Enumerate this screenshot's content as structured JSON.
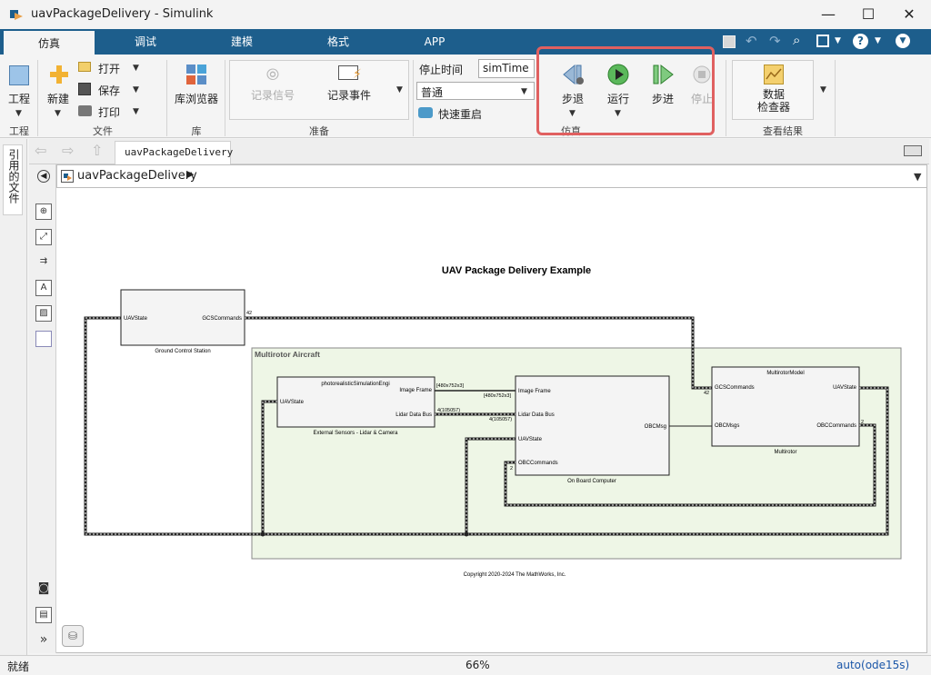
{
  "window": {
    "title": "uavPackageDelivery - Simulink",
    "minimize": "—",
    "maximize": "☐",
    "close": "✕"
  },
  "tabs": [
    {
      "label": "仿真",
      "active": true
    },
    {
      "label": "调试"
    },
    {
      "label": "建模"
    },
    {
      "label": "格式"
    },
    {
      "label": "APP"
    }
  ],
  "ribbon": {
    "project": {
      "label": "工程",
      "group": "工程"
    },
    "file": {
      "new": "新建",
      "open": "打开",
      "save": "保存",
      "print": "打印",
      "group": "文件"
    },
    "library": {
      "browser": "库浏览器",
      "group": "库"
    },
    "prepare": {
      "log_signals": "记录信号",
      "log_events": "记录事件",
      "group": "准备"
    },
    "sim": {
      "stop_time_label": "停止时间",
      "stop_time_value": "simTime",
      "mode_value": "普通",
      "fast_restart": "快速重启"
    },
    "simulate": {
      "step_back": "步退",
      "run": "运行",
      "step_forward": "步进",
      "stop": "停止",
      "group": "仿真"
    },
    "review": {
      "data_inspector": "数据\n检查器",
      "group": "查看结果"
    }
  },
  "left_panel": {
    "label": "引用的文件"
  },
  "editor_tab": {
    "label": "uavPackageDelivery"
  },
  "breadcrumb": {
    "model": "uavPackageDelivery"
  },
  "model": {
    "title": "UAV Package Delivery Example",
    "copyright": "Copyright 2020-2024 The MathWorks, Inc.",
    "subsystem_area": "Multirotor Aircraft",
    "blocks": {
      "gcs": {
        "name": "Ground Control Station",
        "in": "UAVState",
        "out": "GCSCommands"
      },
      "sensors": {
        "name": "External Sensors - Lidar & Camera",
        "header": "photorealisticSimulationEngi",
        "in": "UAVState",
        "out1": "Image Frame",
        "out2": "Lidar Data Bus"
      },
      "obc": {
        "name": "On Board Computer",
        "in1": "Image Frame",
        "in2": "Lidar Data Bus",
        "in3": "UAVState",
        "in4": "OBCCommands",
        "out": "OBCMsg"
      },
      "multirotor": {
        "name": "Multirotor",
        "header": "MultirotorModel",
        "in1": "GCSCommands",
        "in2": "OBCMsgs",
        "out1": "UAVState",
        "out2": "OBCCommands"
      }
    },
    "signal_labels": {
      "gcs_width": "42",
      "img_dim1": "[480x752x3]",
      "img_dim2": "[480x752x3]",
      "lidar1": "4(105057)",
      "lidar2": "4(105057)",
      "gcs_in": "42",
      "obc_cmd": "2",
      "obc_in": "2"
    }
  },
  "status": {
    "ready": "就绪",
    "zoom": "66%",
    "solver": "auto(ode15s)"
  }
}
